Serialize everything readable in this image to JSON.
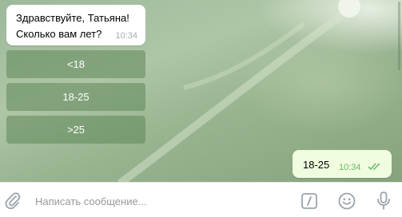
{
  "chat": {
    "incoming": {
      "line1": "Здравствуйте, Татьяна!",
      "line2": "Сколько вам лет?",
      "time": "10:34"
    },
    "keyboard": [
      {
        "label": "<18"
      },
      {
        "label": "18-25"
      },
      {
        "label": ">25"
      }
    ],
    "outgoing": {
      "text": "18-25",
      "time": "10:34",
      "status_icon": "double-check-icon"
    }
  },
  "composer": {
    "placeholder": "Написать сообщение...",
    "value": "",
    "icons": [
      "paperclip-icon",
      "slash-commands-icon",
      "emoji-icon",
      "microphone-icon"
    ]
  },
  "colors": {
    "incoming_bubble": "#ffffff",
    "outgoing_bubble": "#effdde",
    "outgoing_time": "#6db569",
    "keyboard_button": "#6f8f69",
    "composer_icon": "#9aa4ab"
  }
}
